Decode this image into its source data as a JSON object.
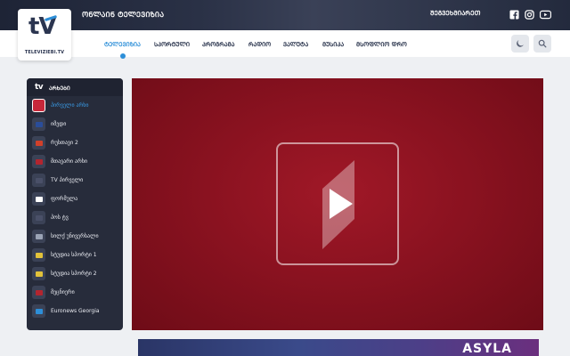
{
  "topbar": {
    "online_label": "ᲝᲜᲚᲐᲘᲜ ᲢᲔᲚᲔᲕᲘᲖᲘᲐ",
    "contact_label": "ᲨᲔᲒᲕᲔᲮᲛᲘᲐᲠᲔᲗ",
    "social": [
      "facebook-icon",
      "instagram-icon",
      "youtube-icon"
    ]
  },
  "logo": {
    "mark": "tV",
    "text": "TELEVIZIEBI.TV"
  },
  "nav": {
    "items": [
      {
        "label": "ᲢᲔᲚᲔᲕᲘᲖᲘᲐ",
        "active": true
      },
      {
        "label": "ᲡᲞᲝᲠᲢᲣᲚᲘ",
        "active": false
      },
      {
        "label": "ᲞᲠᲝᲒᲠᲐᲛᲐ",
        "active": false
      },
      {
        "label": "ᲠᲐᲓᲘᲝ",
        "active": false
      },
      {
        "label": "ᲕᲐᲚᲣᲢᲐ",
        "active": false
      },
      {
        "label": "ᲛᲣᲡᲘᲙᲐ",
        "active": false
      },
      {
        "label": "ᲛᲡᲝᲤᲚᲘᲝ ᲓᲠᲝ",
        "active": false
      }
    ],
    "buttons": [
      "moon-icon",
      "search-icon"
    ]
  },
  "sidebar": {
    "mark": "tv",
    "title": "ᲐᲠᲮᲔᲑᲘ",
    "channels": [
      {
        "name": "პირველი არხი",
        "active": true,
        "color": "#c8283a"
      },
      {
        "name": "იმედი",
        "active": false,
        "color": "#2a4d9a"
      },
      {
        "name": "რუსთავი 2",
        "active": false,
        "color": "#d1402a"
      },
      {
        "name": "მთავარი არხი",
        "active": false,
        "color": "#b3252f"
      },
      {
        "name": "TV პირველი",
        "active": false,
        "color": "#4a5068"
      },
      {
        "name": "ფორმულა",
        "active": false,
        "color": "#ffffff"
      },
      {
        "name": "პოს ტვ",
        "active": false,
        "color": "#4a5068"
      },
      {
        "name": "სილქ უნივერსალი",
        "active": false,
        "color": "#9aa3b5"
      },
      {
        "name": "სტუდია სპორტი 1",
        "active": false,
        "color": "#e2c23a"
      },
      {
        "name": "სტუდია სპორტი 2",
        "active": false,
        "color": "#e2c23a"
      },
      {
        "name": "მეცნიერი",
        "active": false,
        "color": "#b3252f"
      },
      {
        "name": "Euronews Georgia",
        "active": false,
        "color": "#2d8fd8"
      }
    ]
  },
  "player": {
    "play_icon": "play-icon"
  },
  "banner": {
    "text": "ASYLA"
  }
}
